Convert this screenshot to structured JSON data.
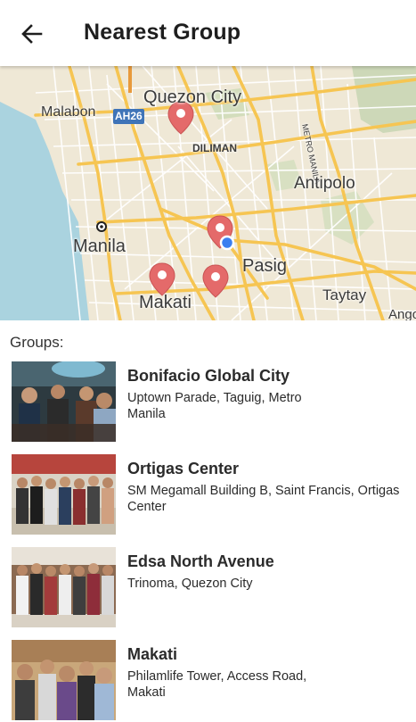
{
  "header": {
    "title": "Nearest Group",
    "back_icon": "arrow-left-icon"
  },
  "map": {
    "labels": {
      "quezon_city": "Quezon City",
      "malabon": "Malabon",
      "ah26": "AH26",
      "diliman": "DILIMAN",
      "metro_manila": "METRO MANILA",
      "antipolo": "Antipolo",
      "manila": "Manila",
      "pasig": "Pasig",
      "makati": "Makati",
      "taytay": "Taytay",
      "angono": "Ango"
    },
    "marker_color": "#e46a6a",
    "location_color": "#3b7ff0"
  },
  "list": {
    "heading": "Groups:",
    "groups": [
      {
        "name": "Bonifacio Global City",
        "address": "Uptown Parade, Taguig, Metro Manila"
      },
      {
        "name": "Ortigas Center",
        "address": "SM Megamall Building B, Saint Francis, Ortigas Center"
      },
      {
        "name": "Edsa North Avenue",
        "address": "Trinoma, Quezon City"
      },
      {
        "name": "Makati",
        "address": "Philamlife Tower, Access Road, Makati"
      }
    ]
  }
}
